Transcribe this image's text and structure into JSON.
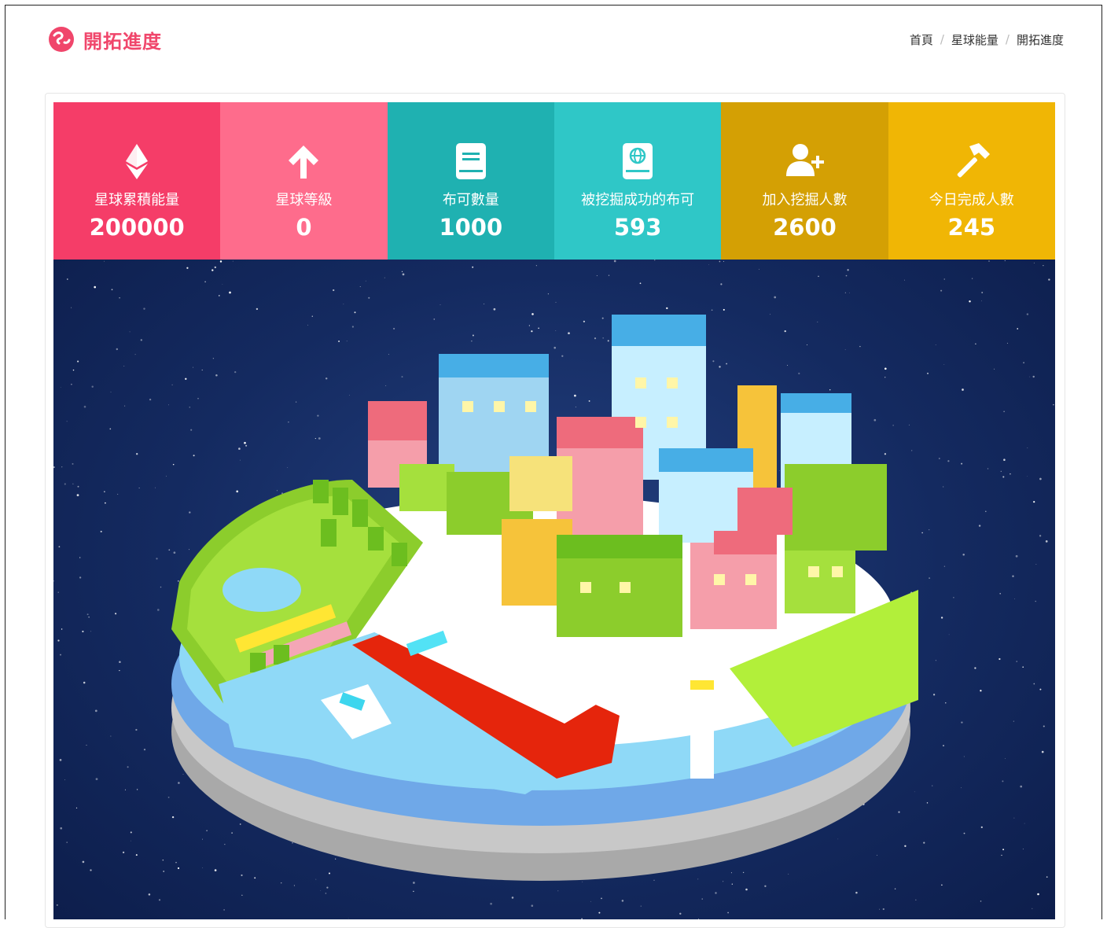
{
  "page": {
    "title": "開拓進度"
  },
  "breadcrumb": [
    "首頁",
    "星球能量",
    "開拓進度"
  ],
  "stats": [
    {
      "label": "星球累積能量",
      "value": "200000",
      "icon": "ethereum-icon",
      "color": "#f53d68"
    },
    {
      "label": "星球等級",
      "value": "0",
      "icon": "arrow-up-icon",
      "color": "#fe6c8c"
    },
    {
      "label": "布可數量",
      "value": "1000",
      "icon": "book-icon",
      "color": "#1fb1b1"
    },
    {
      "label": "被挖掘成功的布可",
      "value": "593",
      "icon": "globe-book-icon",
      "color": "#2fc7c7"
    },
    {
      "label": "加入挖掘人數",
      "value": "2600",
      "icon": "user-plus-icon",
      "color": "#d4a004"
    },
    {
      "label": "今日完成人數",
      "value": "245",
      "icon": "hammer-icon",
      "color": "#f0b605"
    }
  ],
  "colors": {
    "accent": "#f0466b",
    "space": "#142a60"
  }
}
